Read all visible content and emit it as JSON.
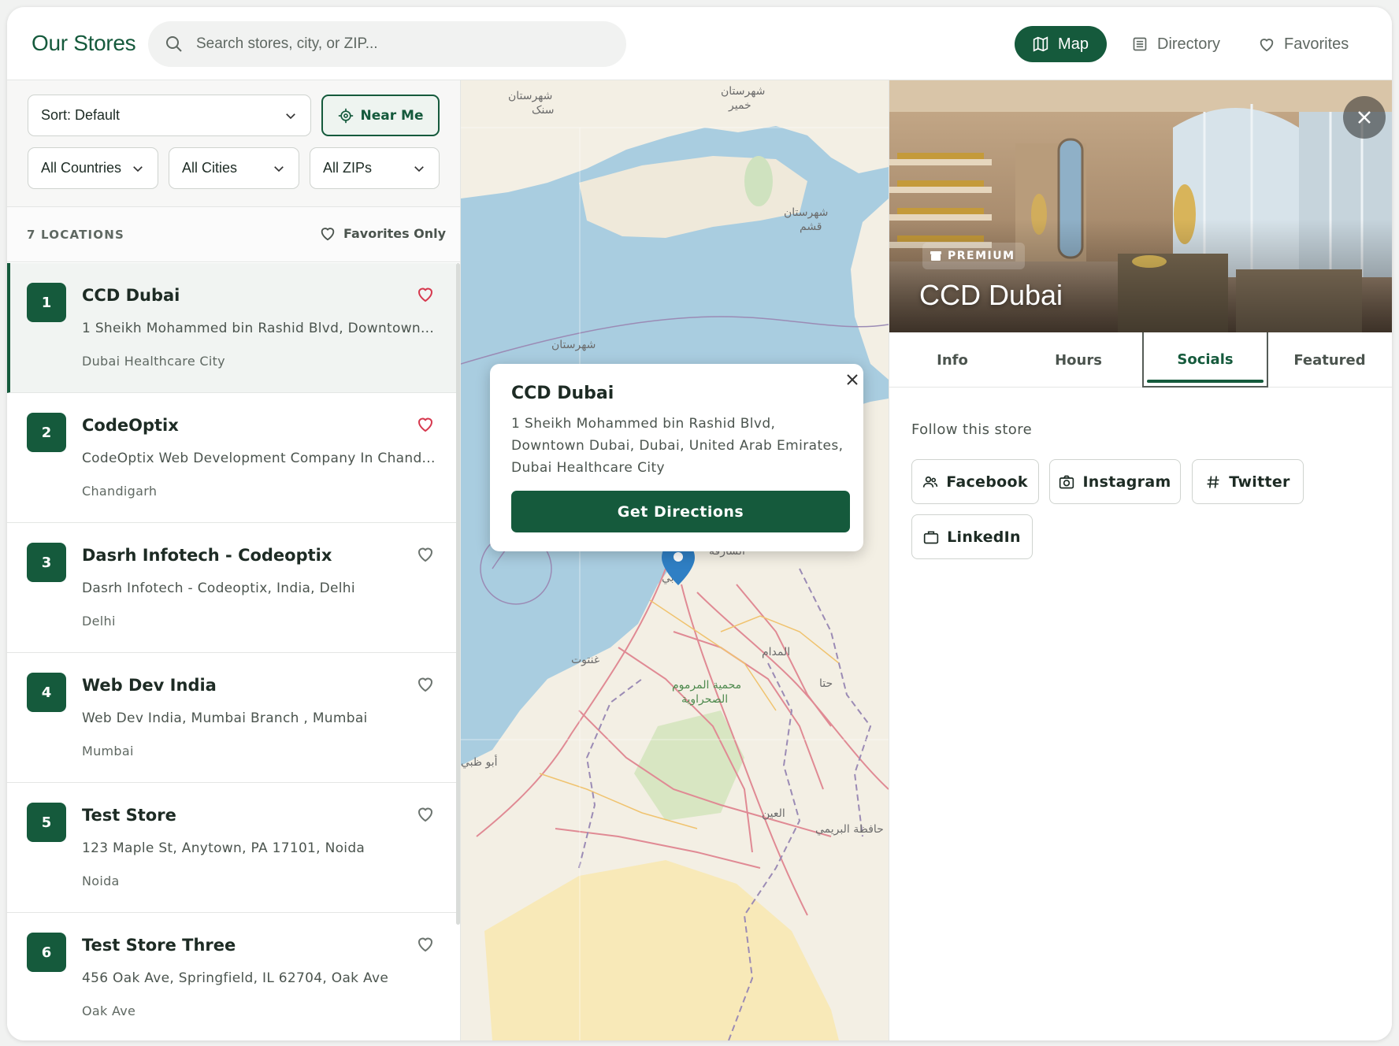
{
  "header": {
    "brand": "Our Stores",
    "search_placeholder": "Search stores, city, or ZIP...",
    "nav": {
      "map": "Map",
      "directory": "Directory",
      "favorites": "Favorites"
    }
  },
  "filters": {
    "sort": "Sort: Default",
    "near_me": "Near Me",
    "country": "All Countries",
    "city": "All Cities",
    "zip": "All ZIPs"
  },
  "list_header": {
    "count": "7 LOCATIONS",
    "favorites_only": "Favorites Only"
  },
  "locations": [
    {
      "num": "1",
      "name": "CCD Dubai",
      "address": "1 Sheikh Mohammed bin Rashid Blvd, Downtown...",
      "city": "Dubai Healthcare City",
      "favorite": true
    },
    {
      "num": "2",
      "name": "CodeOptix",
      "address": "CodeOptix Web Development Company In Chand...",
      "city": "Chandigarh",
      "favorite": true
    },
    {
      "num": "3",
      "name": "Dasrh Infotech - Codeoptix",
      "address": "Dasrh Infotech - Codeoptix, India, Delhi",
      "city": "Delhi",
      "favorite": false
    },
    {
      "num": "4",
      "name": "Web Dev India",
      "address": "Web Dev India, Mumbai Branch , Mumbai",
      "city": "Mumbai",
      "favorite": false
    },
    {
      "num": "5",
      "name": "Test Store",
      "address": "123 Maple St, Anytown, PA 17101, Noida",
      "city": "Noida",
      "favorite": false
    },
    {
      "num": "6",
      "name": "Test Store Three",
      "address": "456 Oak Ave, Springfield, IL 62704, Oak Ave",
      "city": "Oak Ave",
      "favorite": false
    }
  ],
  "popup": {
    "title": "CCD Dubai",
    "address": "1 Sheikh Mohammed bin Rashid Blvd, Downtown Dubai, Dubai, United Arab Emirates, Dubai Healthcare City",
    "button": "Get Directions"
  },
  "detail": {
    "badge": "PREMIUM",
    "title": "CCD Dubai",
    "tabs": [
      "Info",
      "Hours",
      "Socials",
      "Featured"
    ],
    "active_tab": "Socials",
    "follow_label": "Follow this store",
    "socials": [
      "Facebook",
      "Instagram",
      "Twitter",
      "LinkedIn"
    ]
  },
  "colors": {
    "brand": "#155a3c",
    "heart_active": "#d6384e",
    "water": "#a9cde0",
    "land": "#f3efe4"
  }
}
